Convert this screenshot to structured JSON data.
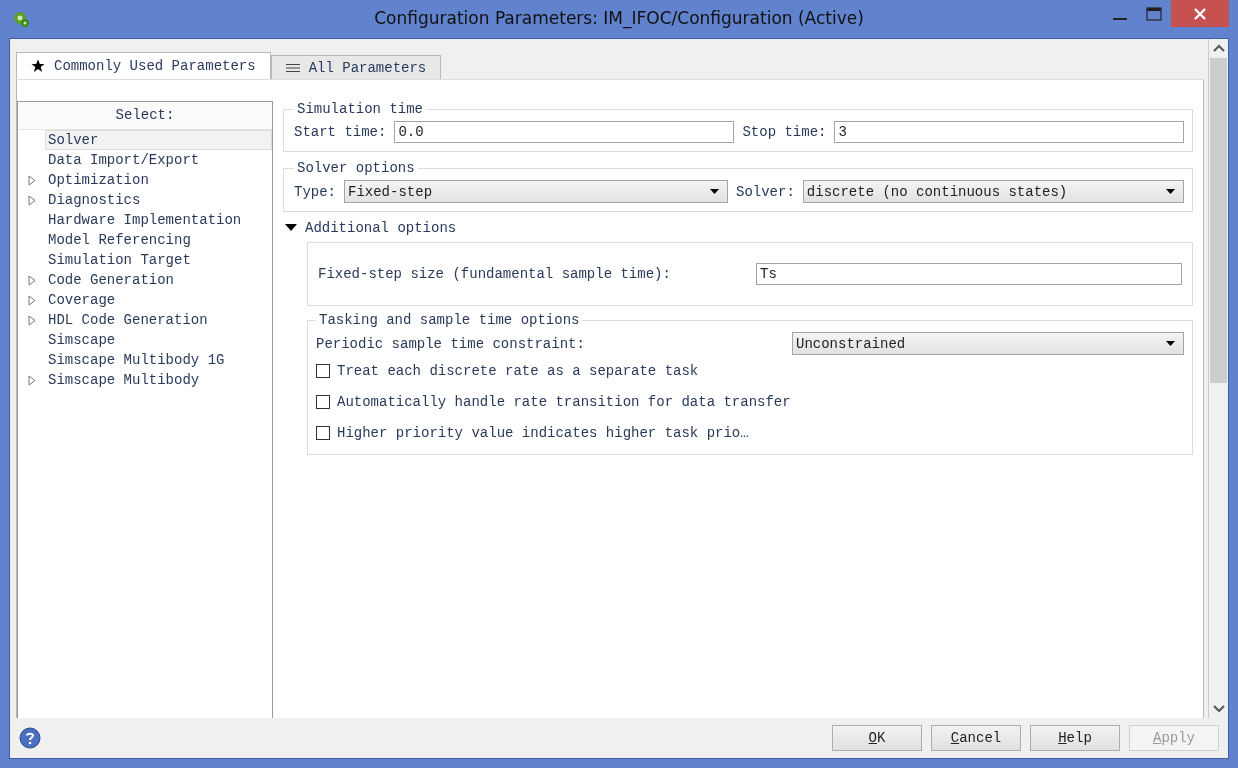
{
  "window": {
    "title": "Configuration Parameters: IM_IFOC/Configuration (Active)"
  },
  "tabs": [
    {
      "label": "Commonly Used Parameters",
      "selected": true,
      "kind": "star"
    },
    {
      "label": "All Parameters",
      "selected": false,
      "kind": "list"
    }
  ],
  "sidebar": {
    "header": "Select:",
    "items": [
      {
        "label": "Solver",
        "expandable": false,
        "selected": true
      },
      {
        "label": "Data Import/Export",
        "expandable": false,
        "selected": false
      },
      {
        "label": "Optimization",
        "expandable": true,
        "selected": false
      },
      {
        "label": "Diagnostics",
        "expandable": true,
        "selected": false
      },
      {
        "label": "Hardware Implementation",
        "expandable": false,
        "selected": false
      },
      {
        "label": "Model Referencing",
        "expandable": false,
        "selected": false
      },
      {
        "label": "Simulation Target",
        "expandable": false,
        "selected": false
      },
      {
        "label": "Code Generation",
        "expandable": true,
        "selected": false
      },
      {
        "label": "Coverage",
        "expandable": true,
        "selected": false
      },
      {
        "label": "HDL Code Generation",
        "expandable": true,
        "selected": false
      },
      {
        "label": "Simscape",
        "expandable": false,
        "selected": false
      },
      {
        "label": "Simscape Multibody 1G",
        "expandable": false,
        "selected": false
      },
      {
        "label": "Simscape Multibody",
        "expandable": true,
        "selected": false
      }
    ]
  },
  "simulation_time": {
    "title": "Simulation time",
    "start_time": {
      "label": "Start time:",
      "value": "0.0"
    },
    "stop_time": {
      "label": "Stop time:",
      "value": "3"
    }
  },
  "solver_options": {
    "title": "Solver options",
    "type": {
      "label": "Type:",
      "value": "Fixed-step"
    },
    "solver": {
      "label": "Solver:",
      "value": "discrete (no continuous states)"
    }
  },
  "additional_options": {
    "label": "Additional options",
    "expanded": true,
    "fixed_step_size": {
      "label": "Fixed-step size (fundamental sample time):",
      "value": "Ts"
    },
    "tasking": {
      "title": "Tasking and sample time options",
      "constraint": {
        "label": "Periodic sample time constraint:",
        "value": "Unconstrained"
      },
      "checkboxes": [
        {
          "label": "Treat each discrete rate as a separate task",
          "checked": false
        },
        {
          "label": "Automatically handle rate transition for data transfer",
          "checked": false
        },
        {
          "label": "Higher priority value indicates higher task prio…",
          "checked": false
        }
      ]
    }
  },
  "buttons": [
    {
      "label": "OK",
      "disabled": false
    },
    {
      "label": "Cancel",
      "disabled": false
    },
    {
      "label": "Help",
      "disabled": false
    },
    {
      "label": "Apply",
      "disabled": true
    }
  ]
}
